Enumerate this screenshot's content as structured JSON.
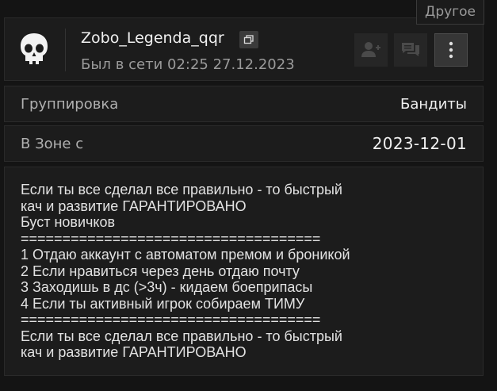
{
  "tooltip": "Другое",
  "profile": {
    "username": "Zobo_Legenda_qqr",
    "last_seen": "Был в сети 02:25 27.12.2023"
  },
  "icons": {
    "avatar": "skull-icon",
    "copy": "copy-icon",
    "add_friend": "add-friend-icon",
    "message": "message-icon",
    "more": "more-vertical-icon"
  },
  "fields": [
    {
      "label": "Группировка",
      "value": "Бандиты"
    },
    {
      "label": "В Зоне с",
      "value": "2023-12-01"
    }
  ],
  "description": {
    "lines": [
      "Если ты все сделал все правильно - то быстрый",
      "кач и развитие ГАРАНТИРОВАНО",
      "Буст новичков",
      "====================================",
      "1 Отдаю аккаунт с автоматом премом и броникой",
      "2 Если нравиться через день отдаю почту",
      "3 Заходишь в дс (>3ч) - кидаем боеприпасы",
      "4 Если ты активный игрок собираем ТИМУ",
      "====================================",
      "Если ты все сделал все правильно - то быстрый",
      "кач и развитие ГАРАНТИРОВАНО"
    ]
  }
}
